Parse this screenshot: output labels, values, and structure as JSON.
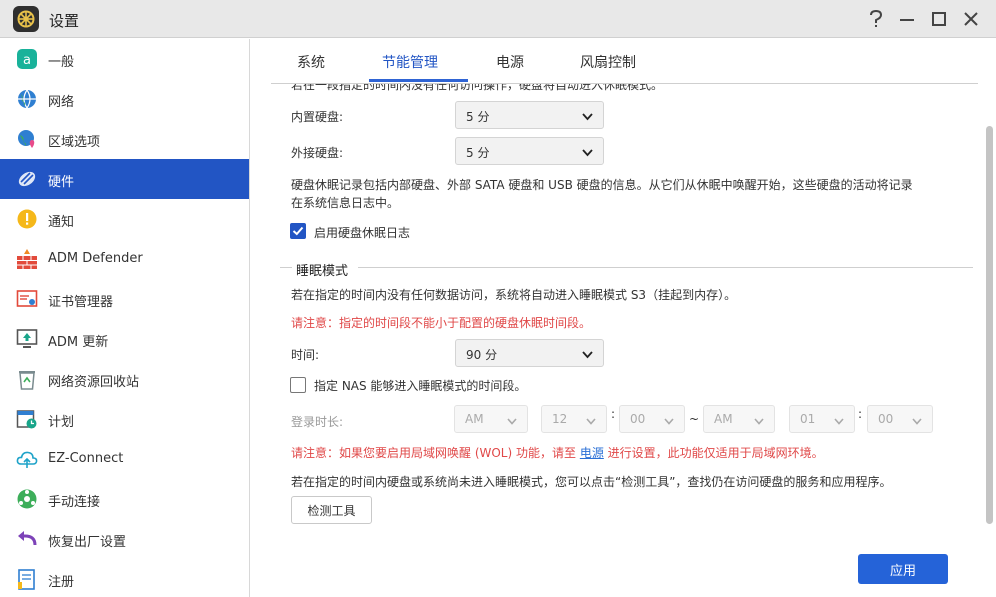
{
  "window": {
    "title": "设置",
    "help_icon": "help-icon",
    "minimize_icon": "minimize-icon",
    "maximize_icon": "maximize-icon",
    "close_icon": "close-icon"
  },
  "sidebar": {
    "items": [
      {
        "label": "一般",
        "icon": "general-icon"
      },
      {
        "label": "网络",
        "icon": "globe-icon"
      },
      {
        "label": "区域选项",
        "icon": "region-icon"
      },
      {
        "label": "硬件",
        "icon": "hardware-icon",
        "active": true
      },
      {
        "label": "通知",
        "icon": "notification-icon"
      },
      {
        "label": "ADM Defender",
        "icon": "firewall-icon"
      },
      {
        "label": "证书管理器",
        "icon": "certificate-icon"
      },
      {
        "label": "ADM 更新",
        "icon": "update-icon"
      },
      {
        "label": "网络资源回收站",
        "icon": "recycle-bin-icon"
      },
      {
        "label": "计划",
        "icon": "schedule-icon"
      },
      {
        "label": "EZ-Connect",
        "icon": "cloud-icon"
      },
      {
        "label": "手动连接",
        "icon": "manual-connect-icon"
      },
      {
        "label": "恢复出厂设置",
        "icon": "factory-reset-icon"
      },
      {
        "label": "注册",
        "icon": "register-icon"
      }
    ]
  },
  "tabs": [
    {
      "label": "系统"
    },
    {
      "label": "节能管理",
      "active": true
    },
    {
      "label": "电源"
    },
    {
      "label": "风扇控制"
    }
  ],
  "content": {
    "top_partial_text": "若在一段指定的时间内没有任何访问操作，硬盘将自动进入休眠模式。",
    "internal_disk": {
      "label": "内置硬盘:",
      "value": "5 分"
    },
    "external_disk": {
      "label": "外接硬盘:",
      "value": "5 分"
    },
    "hibernation_note_line1": "硬盘休眠记录包括内部硬盘、外部 SATA 硬盘和 USB 硬盘的信息。从它们从休眠中唤醒开始，这些硬盘的活动将记录",
    "hibernation_note_line2": "在系统信息日志中。",
    "enable_log": {
      "label": "启用硬盘休眠日志",
      "checked": true
    },
    "sleep_mode": {
      "title": "睡眠模式",
      "description": "若在指定的时间内没有任何数据访问，系统将自动进入睡眠模式 S3（挂起到内存）。",
      "warning": "请注意：指定的时间段不能小于配置的硬盘休眠时间段。",
      "time_label": "时间:",
      "time_value": "90 分",
      "specify_period": {
        "label": "指定 NAS 能够进入睡眠模式的时间段。",
        "checked": false
      },
      "login_duration_label": "登录时长:",
      "start_ampm": "AM",
      "start_hour": "12",
      "start_min": "00",
      "range_sep": "~",
      "end_ampm": "AM",
      "end_hour": "01",
      "end_min": "00",
      "time_colon": ":",
      "wol_warning_prefix": "请注意：如果您要启用局域网唤醒 (WOL) 功能，请至",
      "wol_link": "电源",
      "wol_warning_suffix": "进行设置，此功能仅适用于局域网环境。",
      "detect_note": "若在指定的时间内硬盘或系统尚未进入睡眠模式，您可以点击“检测工具”，查找仍在访问硬盘的服务和应用程序。",
      "detect_button": "检测工具"
    },
    "apply_button": "应用"
  },
  "colors": {
    "accent": "#2255c4",
    "warning": "#e04848",
    "link": "#2a6fd6"
  }
}
